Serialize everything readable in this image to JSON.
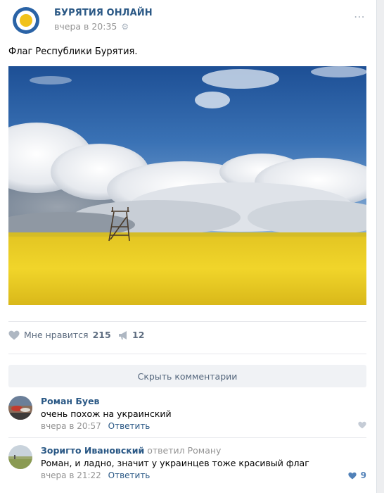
{
  "post": {
    "owner_name": "БУРЯТИЯ ОНЛАЙН",
    "time": "вчера в 20:35",
    "text": "Флаг Республики Бурятия.",
    "image_alt": "Yellow rapeseed field under a blue sky with clouds and a wooden watchtower",
    "colors": {
      "link": "#2a5885",
      "like_icon": "#aeb7c2",
      "accent": "#5181b8"
    }
  },
  "actions": {
    "like_label": "Мне нравится",
    "like_count": "215",
    "share_count": "12"
  },
  "comments_toggle": {
    "label": "Скрыть комментарии"
  },
  "comments": [
    {
      "author": "Роман Буев",
      "reply_to": "",
      "text": "очень похож на украинский",
      "time": "вчера в 20:57",
      "reply_label": "Ответить",
      "likes": ""
    },
    {
      "author": "Зоригто Ивановский",
      "reply_to": "ответил Роману",
      "text": "Роман, и ладно, значит у украинцев тоже красивый флаг",
      "time": "вчера в 21:22",
      "reply_label": "Ответить",
      "likes": "9"
    }
  ]
}
